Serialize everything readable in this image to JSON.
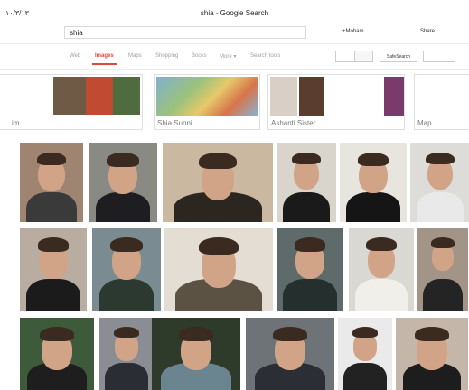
{
  "header": {
    "date": "١٠/٣/١٣",
    "page_title": "shia - Google Search",
    "search_value": "shia",
    "user": "+Moham...",
    "share": "Share"
  },
  "tabs": [
    {
      "label": "Web"
    },
    {
      "label": "Images"
    },
    {
      "label": "Maps"
    },
    {
      "label": "Shopping"
    },
    {
      "label": "Books"
    },
    {
      "label": "More ▾"
    },
    {
      "label": "Search tools"
    }
  ],
  "toolbar": {
    "safesearch_label": "SafeSearch"
  },
  "related": [
    {
      "label": "im"
    },
    {
      "label": "Shia Sunni"
    },
    {
      "label": "Ashanti Sister"
    },
    {
      "label": "Map"
    }
  ],
  "image_rows": [
    {
      "images": [
        {
          "bg": "#a08472",
          "suit": "#3a3a3a"
        },
        {
          "bg": "#8a8a84",
          "suit": "#1e1e22"
        },
        {
          "bg": "#cbb8a0",
          "suit": "#2b2620"
        },
        {
          "bg": "#d9d4cc",
          "suit": "#1a1a1a"
        },
        {
          "bg": "#e8e4de",
          "suit": "#151515"
        },
        {
          "bg": "#dedcd8",
          "suit": "#e9e9e9"
        }
      ]
    },
    {
      "images": [
        {
          "bg": "#b9ada2",
          "suit": "#1b1b1b"
        },
        {
          "bg": "#7a8c92",
          "suit": "#2b3930"
        },
        {
          "bg": "#e4ddd3",
          "suit": "#5b5244"
        },
        {
          "bg": "#5e6b6a",
          "suit": "#25302e"
        },
        {
          "bg": "#dad8d2",
          "suit": "#f0efe9"
        },
        {
          "bg": "#a29486",
          "suit": "#242424"
        }
      ]
    },
    {
      "images": [
        {
          "bg": "#3d5a3a",
          "suit": "#1e1e1e"
        },
        {
          "bg": "#8a8e94",
          "suit": "#2a2d33"
        },
        {
          "bg": "#2e3a2a",
          "suit": "#6b8590"
        },
        {
          "bg": "#6e7378",
          "suit": "#2b2f35"
        },
        {
          "bg": "#eaeaea",
          "suit": "#222"
        },
        {
          "bg": "#c4b7aa",
          "suit": "#1d1d1d"
        }
      ]
    }
  ]
}
